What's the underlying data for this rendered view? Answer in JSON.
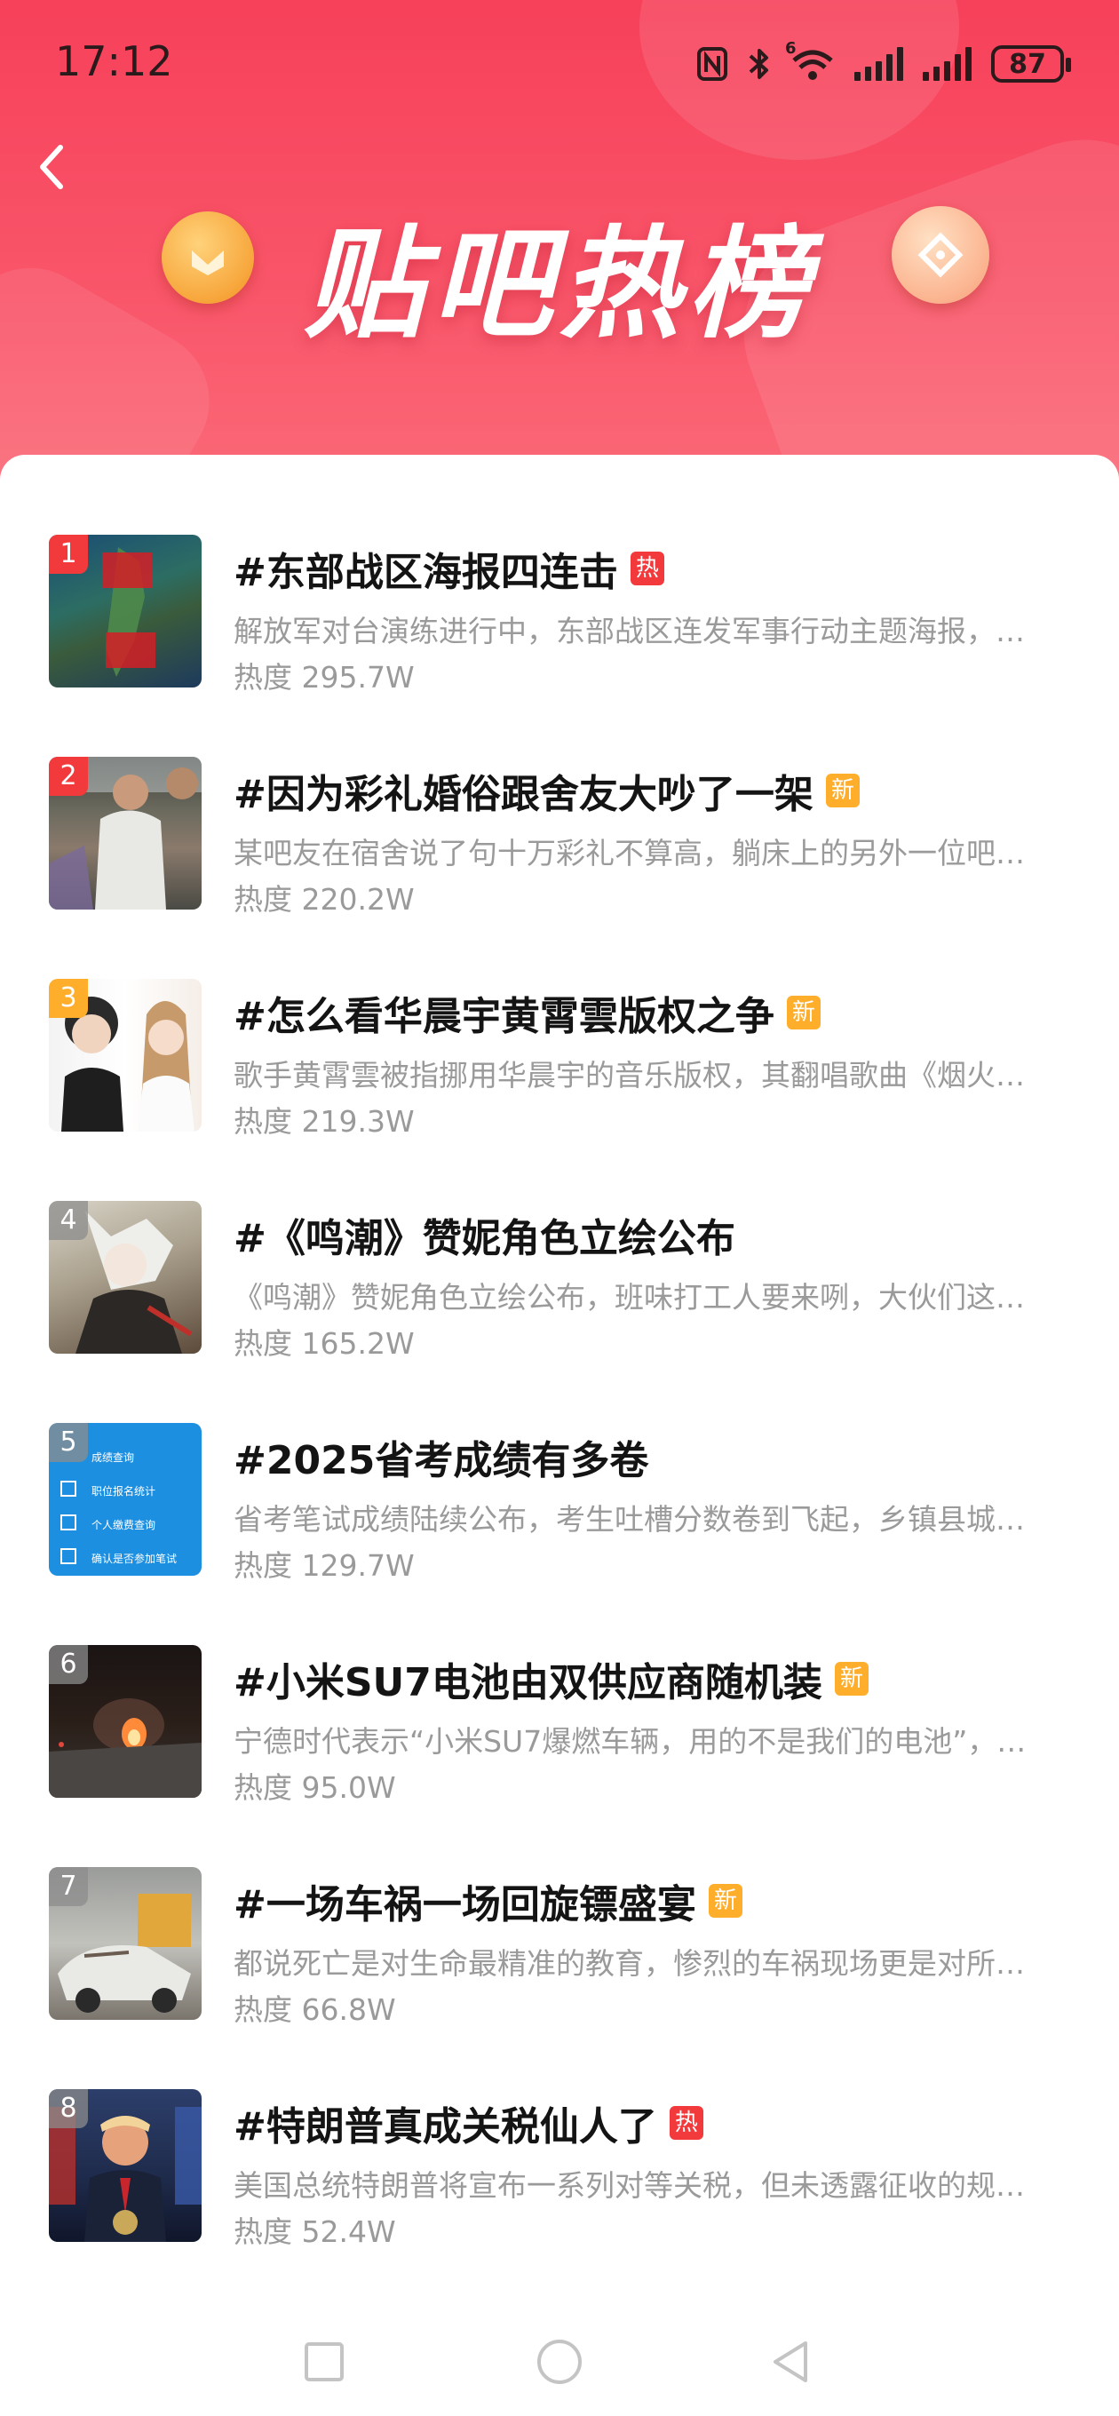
{
  "status": {
    "time": "17:12",
    "battery": "87",
    "net_label": "6",
    "icons": [
      "nfc-icon",
      "bluetooth-icon",
      "wifi-icon",
      "signal-icon",
      "signal-icon",
      "battery-icon"
    ]
  },
  "header": {
    "title": "贴吧热榜",
    "back_icon": "back-chevron-icon"
  },
  "items": [
    {
      "rank": "1",
      "title": "#东部战区海报四连击",
      "tag": "热",
      "tag_type": "hot",
      "desc": "解放军对台演练进行中，东部战区连发军事行动主题海报，…",
      "heat": "热度 295.7W",
      "rank_color": "#f23a3c"
    },
    {
      "rank": "2",
      "title": "#因为彩礼婚俗跟舍友大吵了一架",
      "tag": "新",
      "tag_type": "new",
      "desc": "某吧友在宿舍说了句十万彩礼不算高，躺床上的另外一位吧…",
      "heat": "热度 220.2W",
      "rank_color": "#ff7a2f"
    },
    {
      "rank": "3",
      "title": "#怎么看华晨宇黄霄雲版权之争",
      "tag": "新",
      "tag_type": "new",
      "desc": "歌手黄霄雲被指挪用华晨宇的音乐版权，其翻唱歌曲《烟火…",
      "heat": "热度 219.3W",
      "rank_color": "#ffae2b"
    },
    {
      "rank": "4",
      "title": "#《鸣潮》赞妮角色立绘公布",
      "tag": "",
      "tag_type": "",
      "desc": "《鸣潮》赞妮角色立绘公布，班味打工人要来咧，大伙们这…",
      "heat": "热度 165.2W",
      "rank_color": "#8c8c8c"
    },
    {
      "rank": "5",
      "title": "#2025省考成绩有多卷",
      "tag": "",
      "tag_type": "",
      "desc": "省考笔试成绩陆续公布，考生吐槽分数卷到飞起，乡镇县城…",
      "heat": "热度 129.7W",
      "rank_color": "#8c8c8c"
    },
    {
      "rank": "6",
      "title": "#小米SU7电池由双供应商随机装",
      "tag": "新",
      "tag_type": "new",
      "desc": "宁德时代表示“小米SU7爆燃车辆，用的不是我们的电池”，…",
      "heat": "热度 95.0W",
      "rank_color": "#8c8c8c"
    },
    {
      "rank": "7",
      "title": "#一场车祸一场回旋镖盛宴",
      "tag": "新",
      "tag_type": "new",
      "desc": "都说死亡是对生命最精准的教育，惨烈的车祸现场更是对所…",
      "heat": "热度 66.8W",
      "rank_color": "#8c8c8c"
    },
    {
      "rank": "8",
      "title": "#特朗普真成关税仙人了",
      "tag": "热",
      "tag_type": "hot",
      "desc": "美国总统特朗普将宣布一系列对等关税，但未透露征收的规…",
      "heat": "热度 52.4W",
      "rank_color": "#8c8c8c"
    }
  ],
  "thumb5_lines": [
    "成绩查询",
    "职位报名统计",
    "个人缴费查询",
    "确认是否参加笔试"
  ],
  "nav": {
    "icons": [
      "recents-square-icon",
      "home-circle-icon",
      "back-triangle-icon"
    ]
  },
  "colors": {
    "header_top": "#f7405a",
    "hot_tag": "#f23a3c",
    "new_tag": "#ffae2b",
    "title_text": "#141414",
    "secondary_text": "#9a9a9a"
  }
}
